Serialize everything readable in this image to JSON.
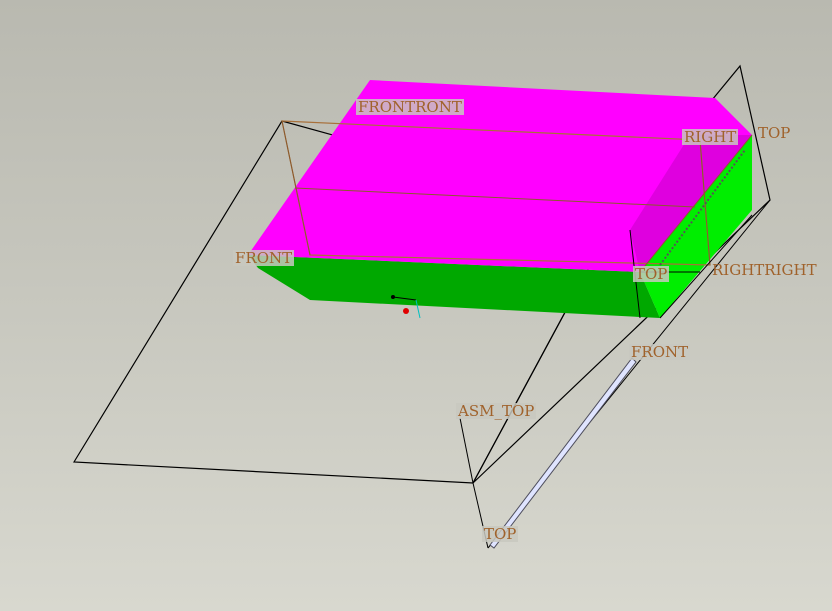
{
  "viewport": {
    "background_top": "#b9b9b0",
    "background_bottom": "#d8d8cf"
  },
  "model": {
    "top_face_color": "#ff00ff",
    "side_face_color_dark": "#00a800",
    "side_face_color_bright": "#00ee00",
    "datum_plane_color": "#000000",
    "datum_plane_part_color": "#a8703a",
    "label_color": "#a0622b"
  },
  "datum_labels": {
    "front_top": "FRONTRONT",
    "right_top": "RIGHT",
    "top_right": "TOP",
    "front_left": "FRONT",
    "top_mid": "TOP",
    "right_right": "RIGHTRIGHT",
    "front_right": "FRONT",
    "asm_top": "ASM_TOP",
    "top_bottom": "TOP"
  },
  "csys": {
    "icon": "coordinate-system-icon"
  }
}
